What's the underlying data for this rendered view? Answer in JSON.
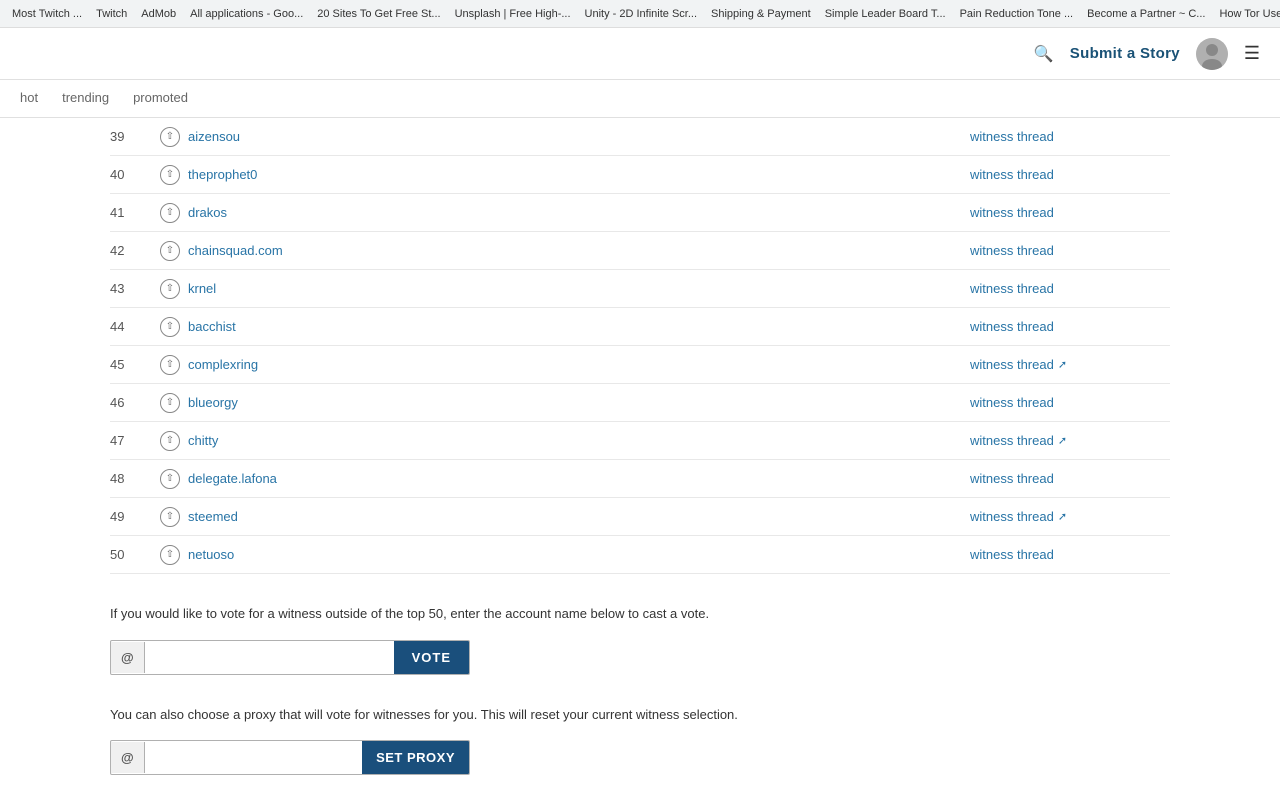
{
  "browser": {
    "bookmarks": [
      "Most Twitch ...",
      "Twitch",
      "AdMob",
      "All applications - Goo...",
      "20 Sites To Get Free St...",
      "Unsplash | Free High-...",
      "Unity - 2D Infinite Scr...",
      "Shipping & Payment",
      "Simple Leader Board T...",
      "Pain Reduction Tone ...",
      "Become a Partner ~ C...",
      "How Tor Users Got Ca..."
    ]
  },
  "header": {
    "submit_story": "Submit a Story",
    "menu_icon": "☰",
    "search_icon": "🔍"
  },
  "nav": {
    "tabs": [
      {
        "label": "hot",
        "active": false
      },
      {
        "label": "trending",
        "active": false
      },
      {
        "label": "promoted",
        "active": false
      }
    ]
  },
  "table": {
    "rows": [
      {
        "num": "39",
        "name": "aizensou",
        "thread": "witness thread",
        "ext": false
      },
      {
        "num": "40",
        "name": "theprophet0",
        "thread": "witness thread",
        "ext": false
      },
      {
        "num": "41",
        "name": "drakos",
        "thread": "witness thread",
        "ext": false
      },
      {
        "num": "42",
        "name": "chainsquad.com",
        "thread": "witness thread",
        "ext": false
      },
      {
        "num": "43",
        "name": "krnel",
        "thread": "witness thread",
        "ext": false
      },
      {
        "num": "44",
        "name": "bacchist",
        "thread": "witness thread",
        "ext": false
      },
      {
        "num": "45",
        "name": "complexring",
        "thread": "witness thread",
        "ext": true
      },
      {
        "num": "46",
        "name": "blueorgy",
        "thread": "witness thread",
        "ext": false
      },
      {
        "num": "47",
        "name": "chitty",
        "thread": "witness thread",
        "ext": true
      },
      {
        "num": "48",
        "name": "delegate.lafona",
        "thread": "witness thread",
        "ext": false
      },
      {
        "num": "49",
        "name": "steemed",
        "thread": "witness thread",
        "ext": true
      },
      {
        "num": "50",
        "name": "netuoso",
        "thread": "witness thread",
        "ext": false
      }
    ]
  },
  "vote_section": {
    "info_text": "If you would like to vote for a witness outside of the top 50, enter the account name below to cast a vote.",
    "at": "@",
    "vote_btn": "VOTE",
    "input_placeholder": ""
  },
  "proxy_section": {
    "info_text": "You can also choose a proxy that will vote for witnesses for you. This will reset your current witness selection.",
    "at": "@",
    "proxy_btn": "SET PROXY",
    "input_placeholder": ""
  }
}
